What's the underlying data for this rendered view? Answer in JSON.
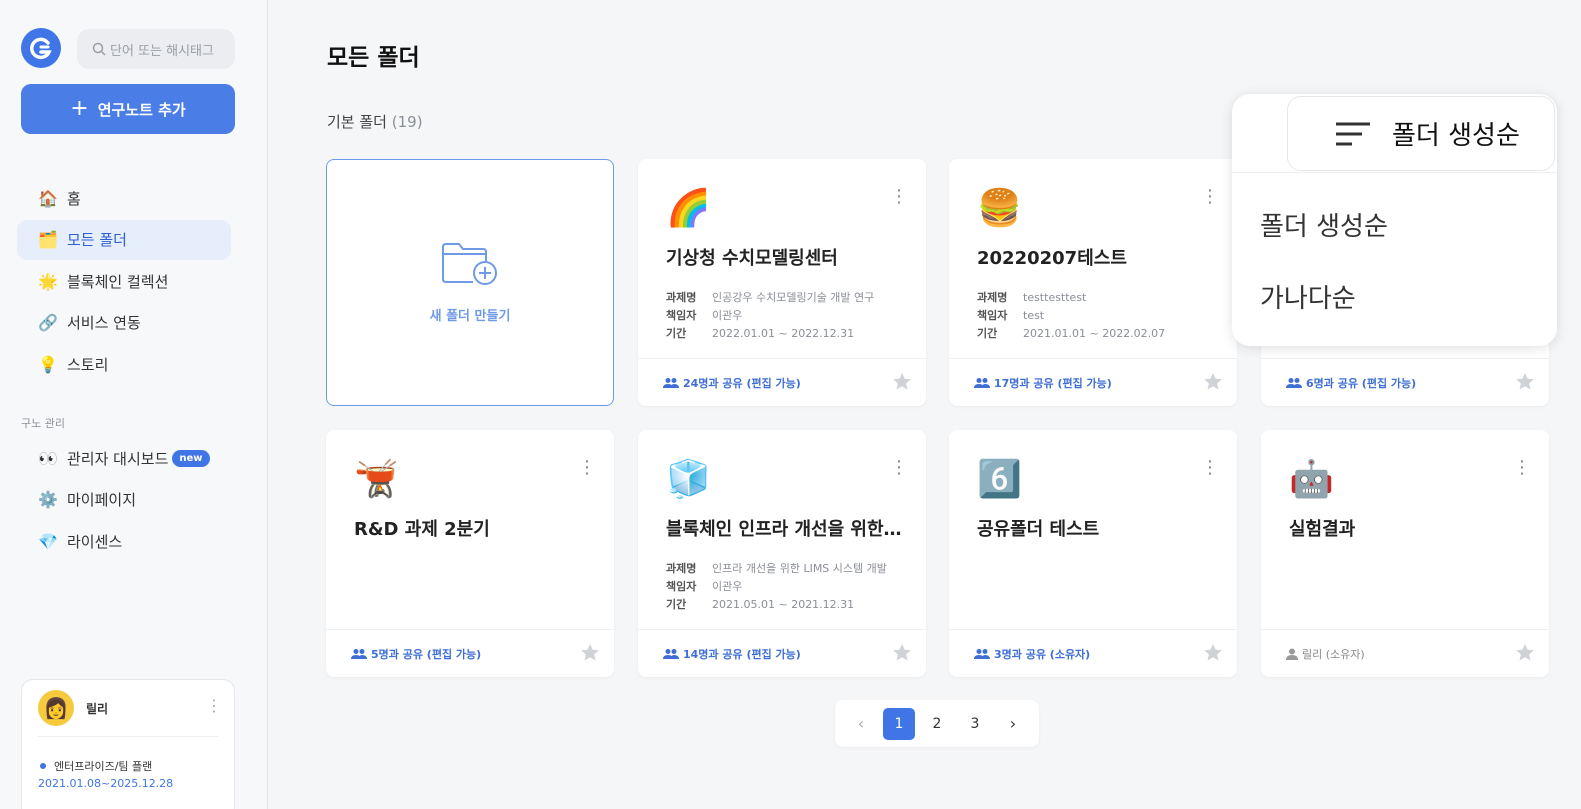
{
  "sidebar": {
    "search_placeholder": "단어 또는 해시태그",
    "add_note_label": "연구노트 추가",
    "nav": [
      {
        "icon": "house-icon",
        "emoji": "🏠",
        "label": "홈"
      },
      {
        "icon": "folder-box-icon",
        "emoji": "🗂️",
        "label": "모든 폴더"
      },
      {
        "icon": "sparkle-star-icon",
        "emoji": "🌟",
        "label": "블록체인 컬렉션"
      },
      {
        "icon": "link-icon",
        "emoji": "🔗",
        "label": "서비스 연동"
      },
      {
        "icon": "lightbulb-icon",
        "emoji": "💡",
        "label": "스토리"
      }
    ],
    "section_label": "구노 관리",
    "nav2": [
      {
        "icon": "eyes-icon",
        "emoji": "👀",
        "label": "관리자 대시보드",
        "badge": "new"
      },
      {
        "icon": "gear-icon",
        "emoji": "⚙️",
        "label": "마이페이지"
      },
      {
        "icon": "gem-icon",
        "emoji": "💎",
        "label": "라이센스"
      }
    ],
    "user": {
      "name": "릴리",
      "plan": "엔터프라이즈/팀 플랜",
      "plan_period": "2021.01.08~2025.12.28"
    }
  },
  "main": {
    "title": "모든 폴더",
    "folder_label": "기본 폴더",
    "folder_count": "(19)",
    "new_folder_label": "새 폴더 만들기",
    "meta_keys": {
      "project": "과제명",
      "lead": "책임자",
      "period": "기간"
    },
    "cards": [
      {
        "emoji": "🌈",
        "icon": "rainbow-icon",
        "title": "기상청 수치모델링센터",
        "project": "인공강우 수치모델링기술 개발 연구",
        "lead": "이관우",
        "period": "2022.01.01 ~ 2022.12.31",
        "share": "24명과 공유 (편집 가능)"
      },
      {
        "emoji": "🍔",
        "icon": "burger-icon",
        "title": "20220207테스트",
        "project": "testtesttest",
        "lead": "test",
        "period": "2021.01.01 ~ 2022.02.07",
        "share": "17명과 공유 (편집 가능)"
      },
      {
        "emoji": "",
        "icon": "",
        "title": "",
        "share": "6명과 공유 (편집 가능)"
      },
      {
        "emoji": "🫕",
        "icon": "fondue-icon",
        "title": "R&D 과제 2분기",
        "share": "5명과 공유 (편집 가능)"
      },
      {
        "emoji": "🧊",
        "icon": "ice-cube-icon",
        "title": "블록체인 인프라 개선을 위한 LIMS 시스템",
        "project": "인프라 개선을 위한 LIMS 시스템 개발",
        "lead": "이관우",
        "period": "2021.05.01 ~ 2021.12.31",
        "share": "14명과 공유 (편집 가능)"
      },
      {
        "emoji": "6️⃣",
        "icon": "keycap-six-icon",
        "title": "공유폴더 테스트",
        "share": "3명과 공유 (소유자)"
      },
      {
        "emoji": "🤖",
        "icon": "robot-icon",
        "title": "실험결과",
        "share": "릴리 (소유자)"
      }
    ],
    "pagination": {
      "pages": [
        "1",
        "2",
        "3"
      ],
      "current": "1"
    }
  },
  "sort": {
    "current": "폴더 생성순",
    "options": [
      "폴더 생성순",
      "가나다순"
    ]
  },
  "colors": {
    "accent": "#3f75e6",
    "share_text": "#3f6fd6"
  }
}
